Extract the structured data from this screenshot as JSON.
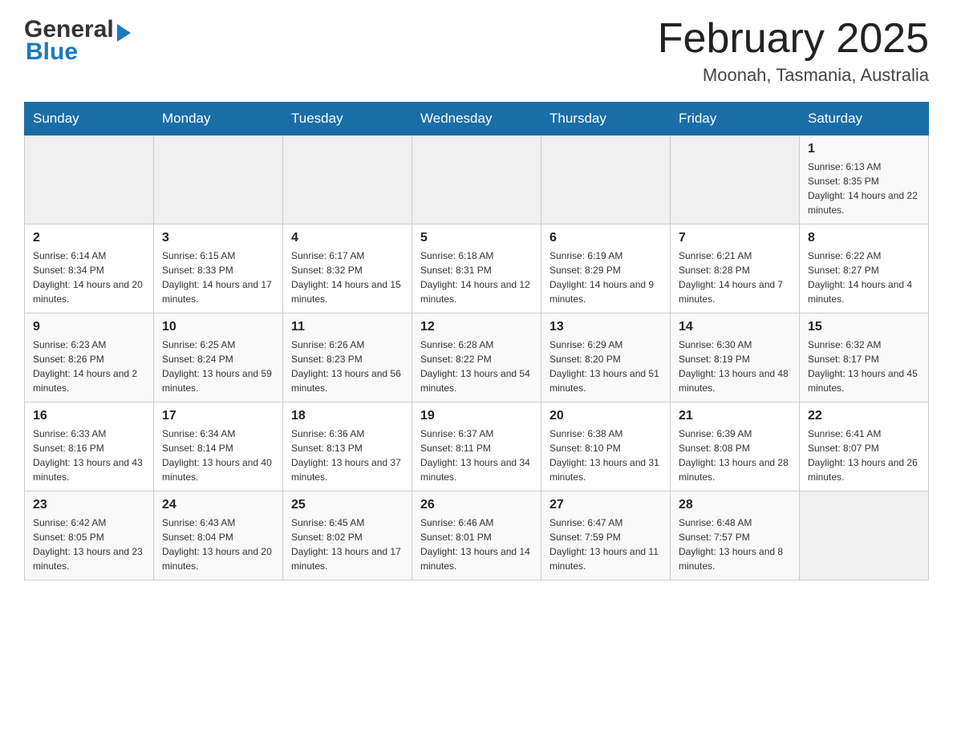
{
  "header": {
    "title": "February 2025",
    "subtitle": "Moonah, Tasmania, Australia",
    "logo_general": "General",
    "logo_blue": "Blue"
  },
  "days_of_week": [
    "Sunday",
    "Monday",
    "Tuesday",
    "Wednesday",
    "Thursday",
    "Friday",
    "Saturday"
  ],
  "weeks": [
    [
      {
        "day": "",
        "info": ""
      },
      {
        "day": "",
        "info": ""
      },
      {
        "day": "",
        "info": ""
      },
      {
        "day": "",
        "info": ""
      },
      {
        "day": "",
        "info": ""
      },
      {
        "day": "",
        "info": ""
      },
      {
        "day": "1",
        "info": "Sunrise: 6:13 AM\nSunset: 8:35 PM\nDaylight: 14 hours and 22 minutes."
      }
    ],
    [
      {
        "day": "2",
        "info": "Sunrise: 6:14 AM\nSunset: 8:34 PM\nDaylight: 14 hours and 20 minutes."
      },
      {
        "day": "3",
        "info": "Sunrise: 6:15 AM\nSunset: 8:33 PM\nDaylight: 14 hours and 17 minutes."
      },
      {
        "day": "4",
        "info": "Sunrise: 6:17 AM\nSunset: 8:32 PM\nDaylight: 14 hours and 15 minutes."
      },
      {
        "day": "5",
        "info": "Sunrise: 6:18 AM\nSunset: 8:31 PM\nDaylight: 14 hours and 12 minutes."
      },
      {
        "day": "6",
        "info": "Sunrise: 6:19 AM\nSunset: 8:29 PM\nDaylight: 14 hours and 9 minutes."
      },
      {
        "day": "7",
        "info": "Sunrise: 6:21 AM\nSunset: 8:28 PM\nDaylight: 14 hours and 7 minutes."
      },
      {
        "day": "8",
        "info": "Sunrise: 6:22 AM\nSunset: 8:27 PM\nDaylight: 14 hours and 4 minutes."
      }
    ],
    [
      {
        "day": "9",
        "info": "Sunrise: 6:23 AM\nSunset: 8:26 PM\nDaylight: 14 hours and 2 minutes."
      },
      {
        "day": "10",
        "info": "Sunrise: 6:25 AM\nSunset: 8:24 PM\nDaylight: 13 hours and 59 minutes."
      },
      {
        "day": "11",
        "info": "Sunrise: 6:26 AM\nSunset: 8:23 PM\nDaylight: 13 hours and 56 minutes."
      },
      {
        "day": "12",
        "info": "Sunrise: 6:28 AM\nSunset: 8:22 PM\nDaylight: 13 hours and 54 minutes."
      },
      {
        "day": "13",
        "info": "Sunrise: 6:29 AM\nSunset: 8:20 PM\nDaylight: 13 hours and 51 minutes."
      },
      {
        "day": "14",
        "info": "Sunrise: 6:30 AM\nSunset: 8:19 PM\nDaylight: 13 hours and 48 minutes."
      },
      {
        "day": "15",
        "info": "Sunrise: 6:32 AM\nSunset: 8:17 PM\nDaylight: 13 hours and 45 minutes."
      }
    ],
    [
      {
        "day": "16",
        "info": "Sunrise: 6:33 AM\nSunset: 8:16 PM\nDaylight: 13 hours and 43 minutes."
      },
      {
        "day": "17",
        "info": "Sunrise: 6:34 AM\nSunset: 8:14 PM\nDaylight: 13 hours and 40 minutes."
      },
      {
        "day": "18",
        "info": "Sunrise: 6:36 AM\nSunset: 8:13 PM\nDaylight: 13 hours and 37 minutes."
      },
      {
        "day": "19",
        "info": "Sunrise: 6:37 AM\nSunset: 8:11 PM\nDaylight: 13 hours and 34 minutes."
      },
      {
        "day": "20",
        "info": "Sunrise: 6:38 AM\nSunset: 8:10 PM\nDaylight: 13 hours and 31 minutes."
      },
      {
        "day": "21",
        "info": "Sunrise: 6:39 AM\nSunset: 8:08 PM\nDaylight: 13 hours and 28 minutes."
      },
      {
        "day": "22",
        "info": "Sunrise: 6:41 AM\nSunset: 8:07 PM\nDaylight: 13 hours and 26 minutes."
      }
    ],
    [
      {
        "day": "23",
        "info": "Sunrise: 6:42 AM\nSunset: 8:05 PM\nDaylight: 13 hours and 23 minutes."
      },
      {
        "day": "24",
        "info": "Sunrise: 6:43 AM\nSunset: 8:04 PM\nDaylight: 13 hours and 20 minutes."
      },
      {
        "day": "25",
        "info": "Sunrise: 6:45 AM\nSunset: 8:02 PM\nDaylight: 13 hours and 17 minutes."
      },
      {
        "day": "26",
        "info": "Sunrise: 6:46 AM\nSunset: 8:01 PM\nDaylight: 13 hours and 14 minutes."
      },
      {
        "day": "27",
        "info": "Sunrise: 6:47 AM\nSunset: 7:59 PM\nDaylight: 13 hours and 11 minutes."
      },
      {
        "day": "28",
        "info": "Sunrise: 6:48 AM\nSunset: 7:57 PM\nDaylight: 13 hours and 8 minutes."
      },
      {
        "day": "",
        "info": ""
      }
    ]
  ]
}
